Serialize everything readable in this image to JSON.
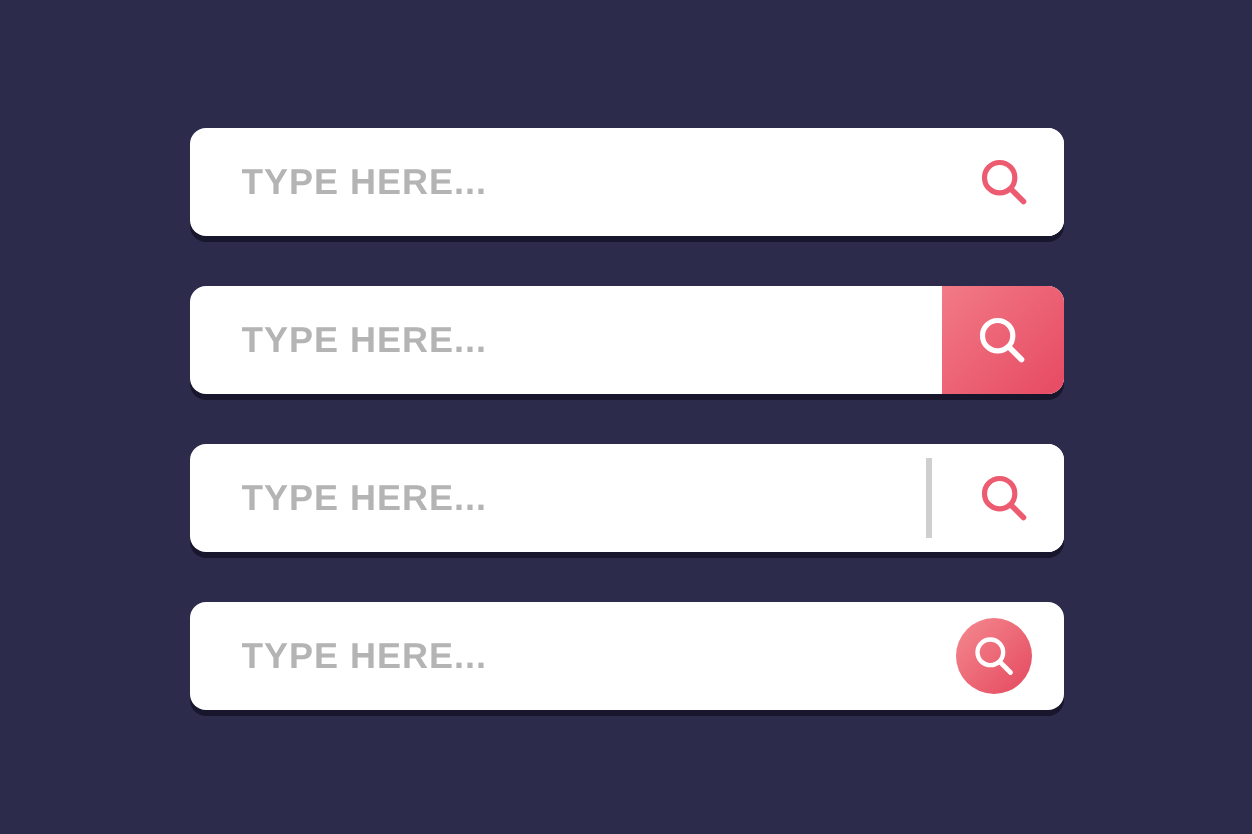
{
  "search_bars": [
    {
      "kind": "icon",
      "placeholder": "TYPE HERE..."
    },
    {
      "kind": "block",
      "placeholder": "TYPE HERE..."
    },
    {
      "kind": "divider",
      "placeholder": "TYPE HERE..."
    },
    {
      "kind": "circle",
      "placeholder": "TYPE HERE..."
    }
  ]
}
